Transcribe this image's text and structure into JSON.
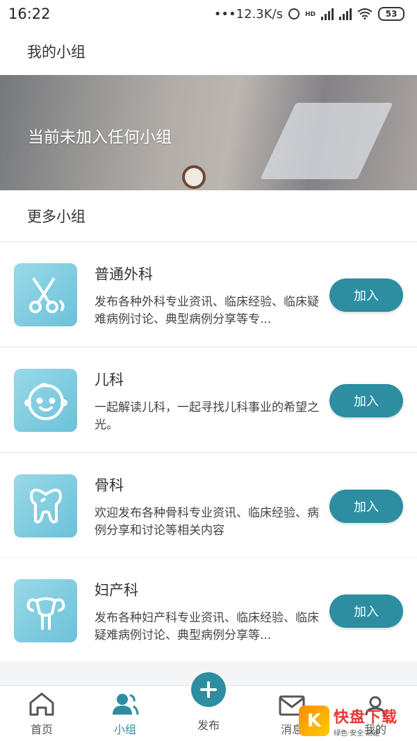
{
  "status_bar": {
    "time": "16:22",
    "network_speed": "•••12.3K/s",
    "hd_label": "HD",
    "battery": "53"
  },
  "my_groups": {
    "title": "我的小组",
    "banner_text": "当前未加入任何小组"
  },
  "more_groups": {
    "title": "更多小组",
    "items": [
      {
        "name": "普通外科",
        "description": "发布各种外科专业资讯、临床经验、临床疑难病例讨论、典型病例分享等专...",
        "join_label": "加入",
        "icon": "scissors-icon"
      },
      {
        "name": "儿科",
        "description": "一起解读儿科，一起寻找儿科事业的希望之光。",
        "join_label": "加入",
        "icon": "baby-face-icon"
      },
      {
        "name": "骨科",
        "description": "欢迎发布各种骨科专业资讯、临床经验、病例分享和讨论等相关内容",
        "join_label": "加入",
        "icon": "bone-icon"
      },
      {
        "name": "妇产科",
        "description": "发布各种妇产科专业资讯、临床经验、临床疑难病例讨论、典型病例分享等...",
        "join_label": "加入",
        "icon": "uterus-icon"
      }
    ]
  },
  "bottom_nav": {
    "items": [
      {
        "label": "首页",
        "icon": "home-icon",
        "active": false
      },
      {
        "label": "小组",
        "icon": "group-icon",
        "active": true
      },
      {
        "label": "发布",
        "icon": "plus-icon",
        "active": false
      },
      {
        "label": "消息",
        "icon": "mail-icon",
        "active": false
      },
      {
        "label": "我的",
        "icon": "user-icon",
        "active": false
      }
    ]
  },
  "watermark": {
    "logo_char": "K",
    "main_text": "快盘下载",
    "sub_text": "绿色·安全·高速"
  },
  "colors": {
    "accent": "#2c8ea0",
    "icon_bg": "#7ccbe0"
  }
}
